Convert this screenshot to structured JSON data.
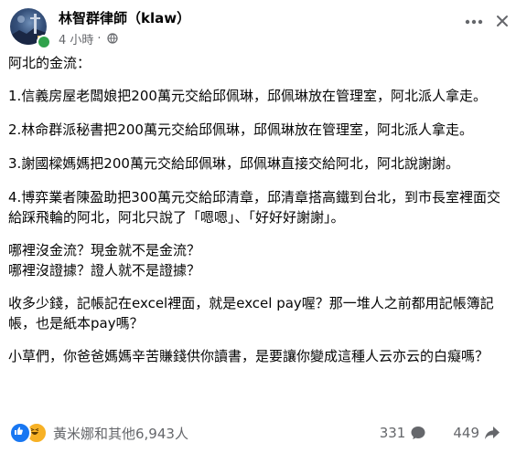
{
  "post": {
    "author": {
      "name": "林智群律師（klaw）",
      "online": true
    },
    "meta": {
      "time": "4 小時",
      "separator": "·",
      "audience_icon": "globe-icon"
    },
    "actions": {
      "more_icon": "more-horizontal-icon",
      "close_icon": "close-icon"
    },
    "paragraphs": [
      "阿北的金流：",
      "1.信義房屋老闆娘把200萬元交給邱佩琳，邱佩琳放在管理室，阿北派人拿走。",
      "2.林命群派秘書把200萬元交給邱佩琳，邱佩琳放在管理室，阿北派人拿走。",
      "3.謝國樑媽媽把200萬元交給邱佩琳，邱佩琳直接交給阿北，阿北說謝謝。",
      "4.博弈業者陳盈助把300萬元交給邱清章，邱清章搭高鐵到台北，到市長室裡面交給踩飛輪的阿北，阿北只說了「嗯嗯」、「好好好謝謝」。",
      "哪裡沒金流？現金就不是金流？\n哪裡沒證據？證人就不是證據？",
      "收多少錢，記帳記在excel裡面，就是excel pay喔？那一堆人之前都用記帳簿記帳，也是紙本pay嗎？",
      "小草們，你爸爸媽媽辛苦賺錢供你讀書，是要讓你變成這種人云亦云的白癡嗎？"
    ],
    "footer": {
      "reaction_icons": [
        "like-icon",
        "haha-icon"
      ],
      "reaction_summary": "黃米娜和其他6,943人",
      "comments_count": "331",
      "comments_icon": "comment-icon",
      "shares_count": "449",
      "shares_icon": "share-icon"
    },
    "colors": {
      "text": "#050505",
      "secondary": "#65676b",
      "online": "#31a24c",
      "like": "#1877f2",
      "haha": "#f7b125"
    }
  }
}
